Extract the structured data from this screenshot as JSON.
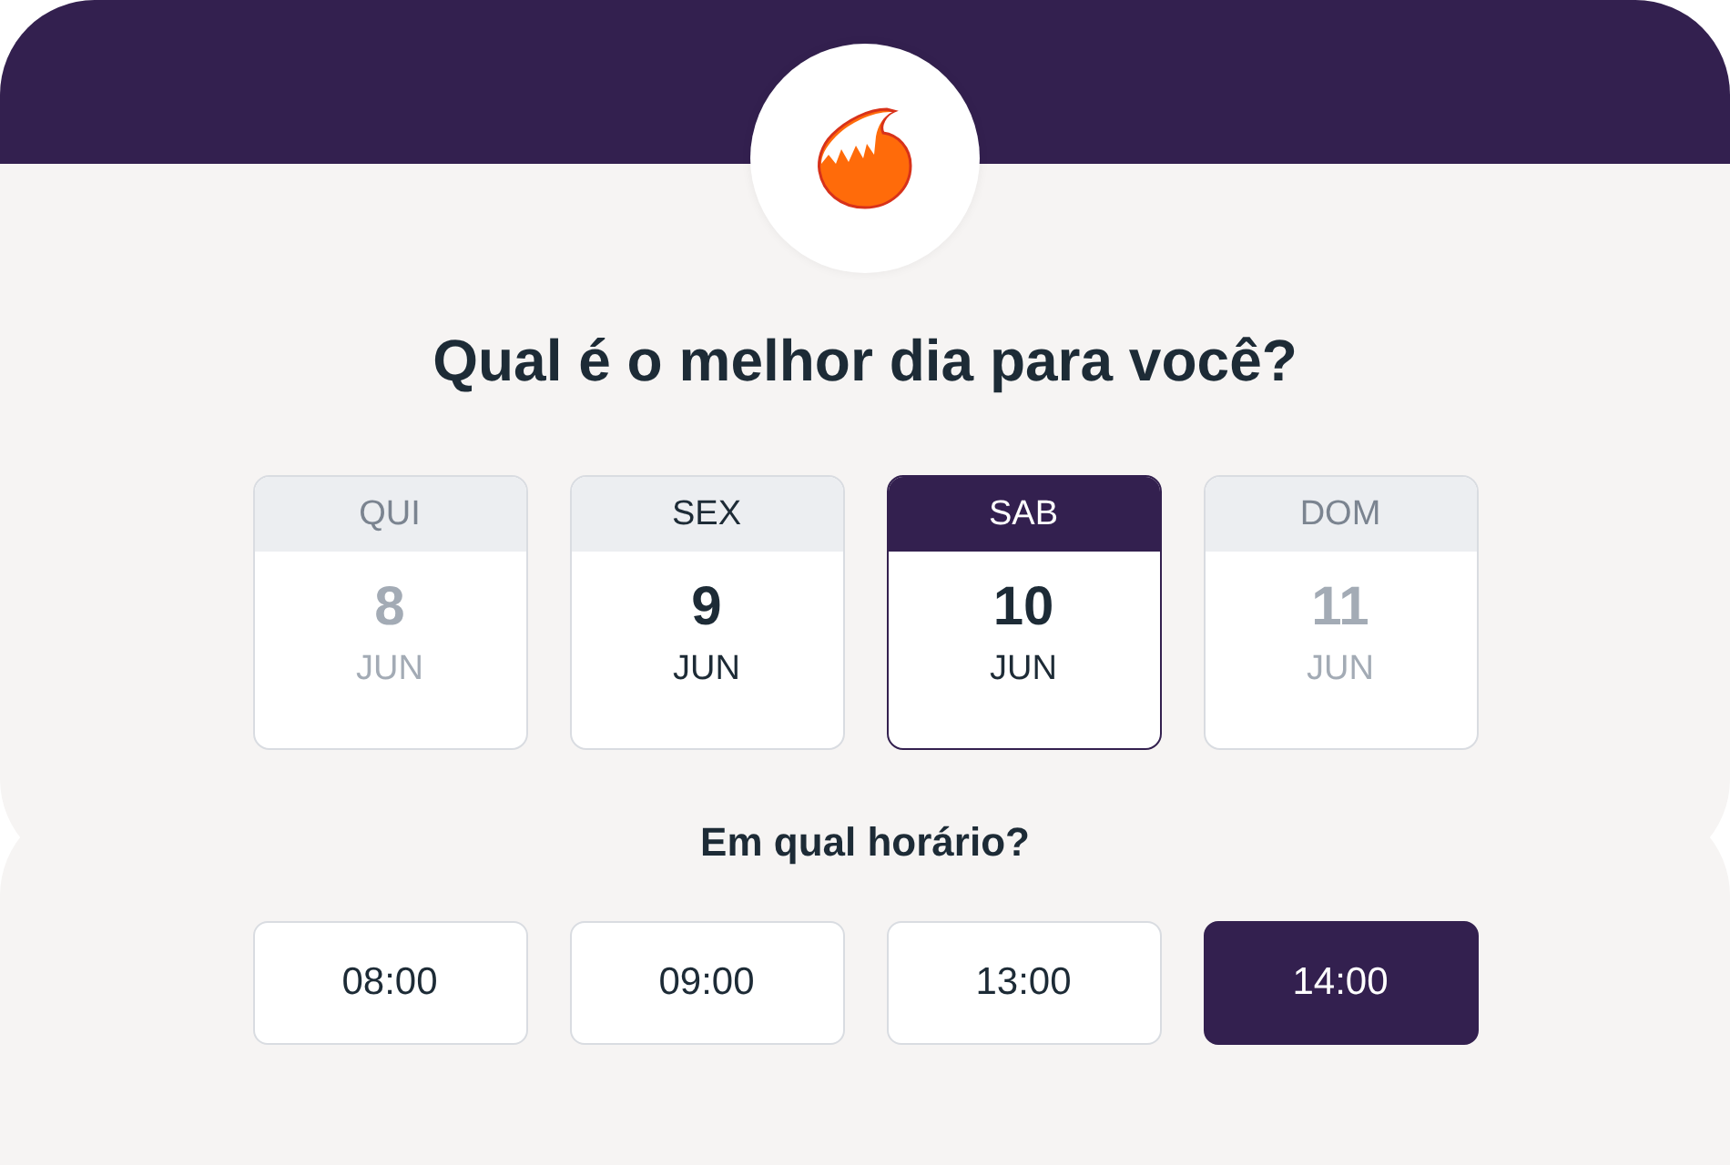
{
  "title": "Qual é o melhor dia para você?",
  "days": [
    {
      "weekday": "QUI",
      "day": "8",
      "month": "JUN",
      "selected": false,
      "disabled": true
    },
    {
      "weekday": "SEX",
      "day": "9",
      "month": "JUN",
      "selected": false,
      "disabled": false
    },
    {
      "weekday": "SAB",
      "day": "10",
      "month": "JUN",
      "selected": true,
      "disabled": false
    },
    {
      "weekday": "DOM",
      "day": "11",
      "month": "JUN",
      "selected": false,
      "disabled": true
    }
  ],
  "time_title": "Em qual horário?",
  "times": [
    {
      "label": "08:00",
      "selected": false
    },
    {
      "label": "09:00",
      "selected": false
    },
    {
      "label": "13:00",
      "selected": false
    },
    {
      "label": "14:00",
      "selected": true
    }
  ]
}
